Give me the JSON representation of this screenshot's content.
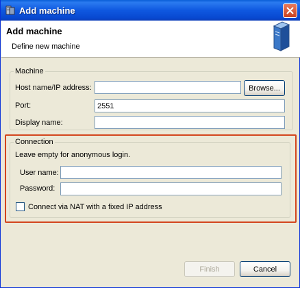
{
  "window": {
    "title": "Add machine",
    "icons": {
      "app": "server-app-icon",
      "close": "close-icon"
    }
  },
  "header": {
    "title": "Add machine",
    "subtitle": "Define new machine",
    "icon": "server-tower-icon"
  },
  "machine_group": {
    "label": "Machine",
    "host_label": "Host name/IP address:",
    "host_value": "",
    "browse_label": "Browse...",
    "port_label": "Port:",
    "port_value": "2551",
    "display_label": "Display name:",
    "display_value": ""
  },
  "connection_group": {
    "label": "Connection",
    "hint": "Leave empty for anonymous login.",
    "user_label": "User name:",
    "user_value": "",
    "password_label": "Password:",
    "password_value": "",
    "nat_label": "Connect via NAT with a fixed IP address",
    "nat_checked": false
  },
  "footer": {
    "finish_label": "Finish",
    "cancel_label": "Cancel"
  },
  "colors": {
    "titlebar": "#0a5fd8",
    "highlight": "#d3451d",
    "input_border": "#7f9db9"
  }
}
